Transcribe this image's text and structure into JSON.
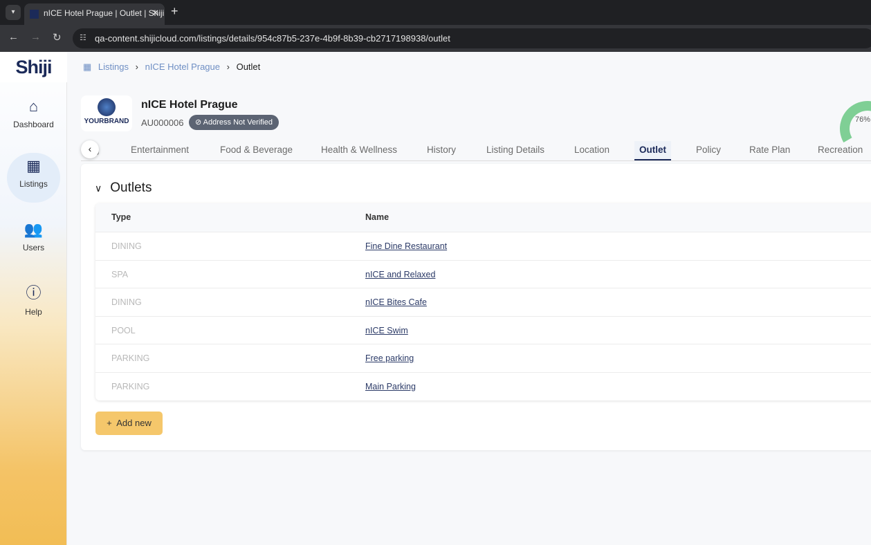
{
  "browser": {
    "tab_title": "nICE Hotel Prague | Outlet | Shiji",
    "url": "qa-content.shijicloud.com/listings/details/954c87b5-237e-4b9f-8b39-cb2717198938/outlet"
  },
  "sidebar": {
    "logo": "Shiji",
    "items": [
      {
        "label": "Dashboard",
        "icon": "home-icon"
      },
      {
        "label": "Listings",
        "icon": "building-icon"
      },
      {
        "label": "Users",
        "icon": "users-icon"
      },
      {
        "label": "Help",
        "icon": "help-icon"
      }
    ]
  },
  "breadcrumb": [
    "Listings",
    "nICE Hotel Prague",
    "Outlet"
  ],
  "header": {
    "brand": "YOURBRAND",
    "title": "nICE Hotel Prague",
    "id": "AU000006",
    "badge": "Address Not Verified",
    "completion": "76%"
  },
  "tabs": [
    "g",
    "Entertainment",
    "Food & Beverage",
    "Health & Wellness",
    "History",
    "Listing Details",
    "Location",
    "Outlet",
    "Policy",
    "Rate Plan",
    "Recreation"
  ],
  "section": {
    "title": "Outlets",
    "columns": [
      "Type",
      "Name"
    ],
    "rows": [
      {
        "type": "DINING",
        "name": "Fine Dine Restaurant"
      },
      {
        "type": "SPA",
        "name": "nICE and Relaxed"
      },
      {
        "type": "DINING",
        "name": "nICE Bites Cafe"
      },
      {
        "type": "POOL",
        "name": "nICE Swim"
      },
      {
        "type": "PARKING",
        "name": "Free parking"
      },
      {
        "type": "PARKING",
        "name": "Main Parking"
      }
    ],
    "add_label": "Add new"
  }
}
